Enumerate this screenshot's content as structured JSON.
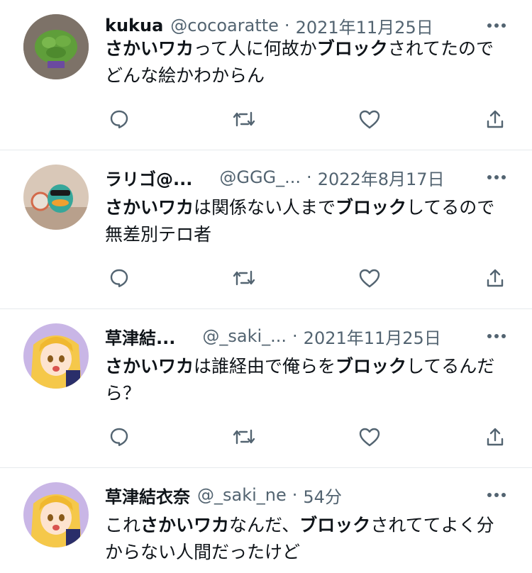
{
  "tweets": [
    {
      "name": "kukua",
      "handle": "@cocoaratte",
      "separator": "·",
      "time": "2021年11月25日",
      "body": [
        {
          "text": "さかいワカ",
          "bold": true
        },
        {
          "text": "って人に何故か",
          "bold": false
        },
        {
          "text": "ブロック",
          "bold": true
        },
        {
          "text": "されてたのでどんな絵かわからん",
          "bold": false
        }
      ]
    },
    {
      "name": "ラリゴ@...",
      "handle": "@GGG_...",
      "separator": "·",
      "time": "2022年8月17日",
      "body": [
        {
          "text": "さかいワカ",
          "bold": true
        },
        {
          "text": "は関係ない人まで",
          "bold": false
        },
        {
          "text": "ブロック",
          "bold": true
        },
        {
          "text": "してるので無差別テロ者",
          "bold": false
        }
      ]
    },
    {
      "name": "草津結...",
      "handle": "@_saki_...",
      "separator": "·",
      "time": "2021年11月25日",
      "body": [
        {
          "text": "さかいワカ",
          "bold": true
        },
        {
          "text": "は誰経由で俺らを",
          "bold": false
        },
        {
          "text": "ブロック",
          "bold": true
        },
        {
          "text": "してるんだら？",
          "bold": false
        }
      ]
    },
    {
      "name": "草津結衣奈",
      "handle": "@_saki_ne",
      "separator": "·",
      "time": "54分",
      "body": [
        {
          "text": "これ",
          "bold": false
        },
        {
          "text": "さかいワカ",
          "bold": true
        },
        {
          "text": "なんだ、",
          "bold": false
        },
        {
          "text": "ブロック",
          "bold": true
        },
        {
          "text": "されててよく分からない人間だったけど",
          "bold": false
        }
      ]
    }
  ],
  "icons": {
    "more": "more-icon",
    "reply": "reply-icon",
    "retweet": "retweet-icon",
    "like": "like-icon",
    "share": "share-icon"
  },
  "colors": {
    "text": "#0f1419",
    "secondary": "#536471",
    "divider": "#e6e9ec"
  }
}
